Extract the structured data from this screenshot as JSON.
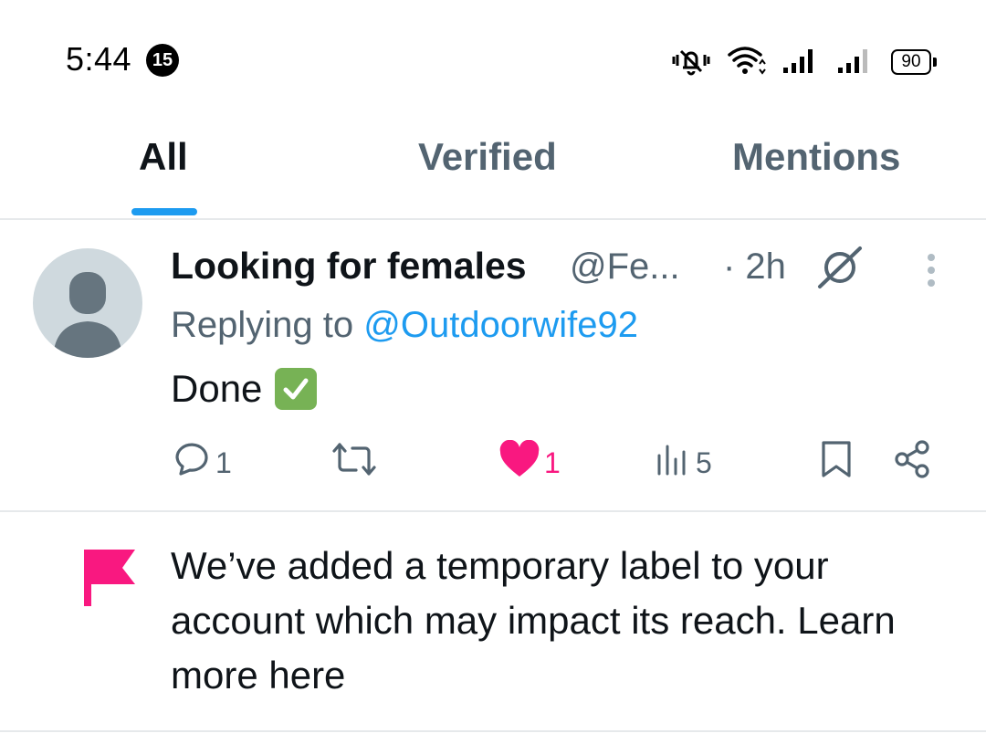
{
  "status_bar": {
    "time": "5:44",
    "notification_count": "15",
    "battery_level": "90"
  },
  "tabs": [
    {
      "label": "All",
      "active": true
    },
    {
      "label": "Verified",
      "active": false
    },
    {
      "label": "Mentions",
      "active": false
    }
  ],
  "post": {
    "author_name": "Looking for females",
    "author_handle": "@Fe...",
    "time": "· 2h",
    "reply_prefix": "Replying to",
    "reply_handle": "@Outdoorwife92",
    "text": "Done",
    "actions": {
      "reply_count": "1",
      "like_count": "1",
      "view_count": "5"
    }
  },
  "notice": {
    "text": "We’ve added a temporary label to your account which may impact its reach. Learn more here"
  },
  "colors": {
    "accent": "#1d9bf0",
    "like": "#f91880",
    "secondary_text": "#536471",
    "primary_text": "#0f1419"
  }
}
